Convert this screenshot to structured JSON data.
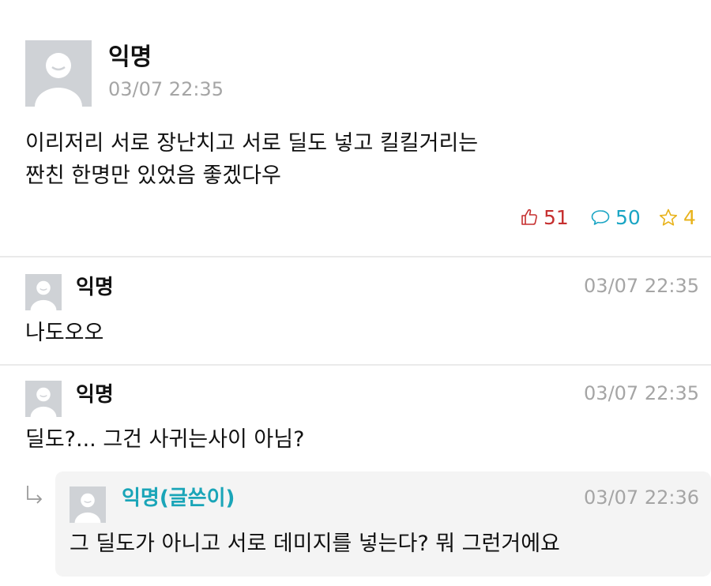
{
  "post": {
    "author": "익명",
    "time": "03/07 22:35",
    "body_line1": "이리저리 서로 장난치고 서로 딜도 넣고 킬킬거리는",
    "body_line2": "짠친 한명만 있었음 좋겠다우",
    "likes": "51",
    "comments": "50",
    "scraps": "4",
    "colors": {
      "like": "#c62f2f",
      "comment": "#1aa5c4",
      "scrap": "#e8b21a"
    }
  },
  "comments": [
    {
      "author": "익명",
      "time": "03/07 22:35",
      "text": "나도오오"
    },
    {
      "author": "익명",
      "time": "03/07 22:35",
      "text": "딜도?... 그건 사귀는사이 아님?"
    }
  ],
  "reply": {
    "author": "익명(글쓴이)",
    "time": "03/07 22:36",
    "text": "그 딜도가 아니고 서로 데미지를 넣는다? 뭐 그런거에요",
    "author_color": "#1aa5b8"
  },
  "icons": {
    "avatar": "default-profile-icon",
    "like": "thumbs-up-icon",
    "comment": "speech-bubble-icon",
    "scrap": "star-icon",
    "reply_arrow": "reply-arrow-icon"
  }
}
